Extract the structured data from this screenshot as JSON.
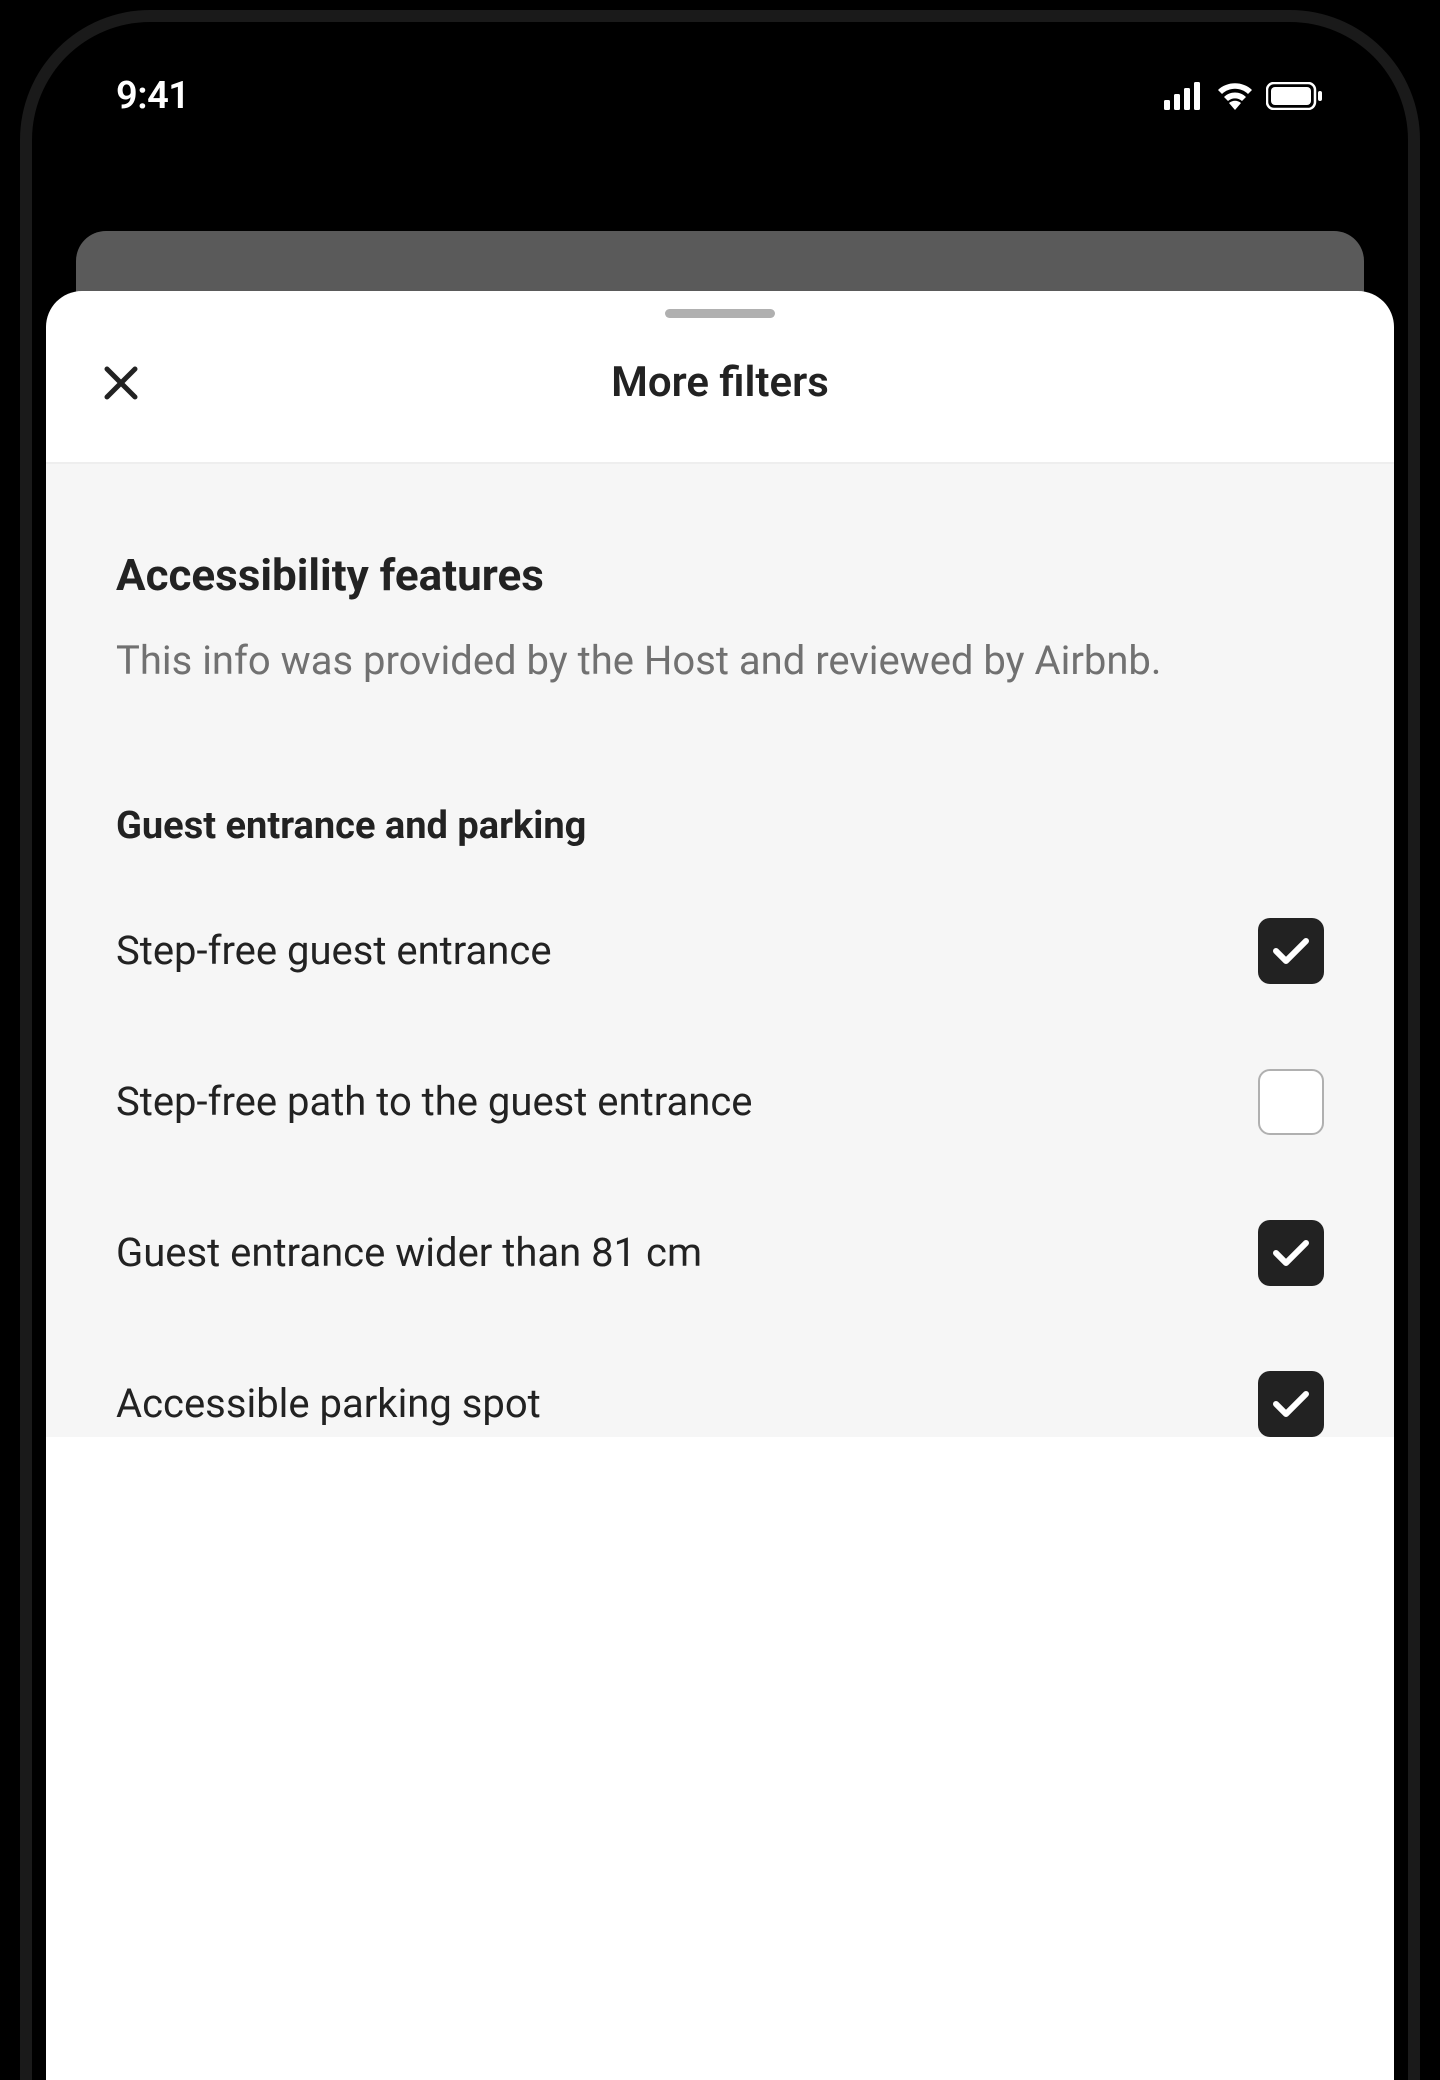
{
  "status_bar": {
    "time": "9:41"
  },
  "modal": {
    "title": "More filters"
  },
  "section": {
    "title": "Accessibility features",
    "subtitle": "This info was provided by the Host and reviewed by Airbnb."
  },
  "subsection": {
    "title": "Guest entrance and parking"
  },
  "options": [
    {
      "label": "Step-free guest entrance",
      "checked": true
    },
    {
      "label": "Step-free path to the guest entrance",
      "checked": false
    },
    {
      "label": "Guest entrance wider than 81 cm",
      "checked": true
    },
    {
      "label": "Accessible parking spot",
      "checked": true
    }
  ]
}
